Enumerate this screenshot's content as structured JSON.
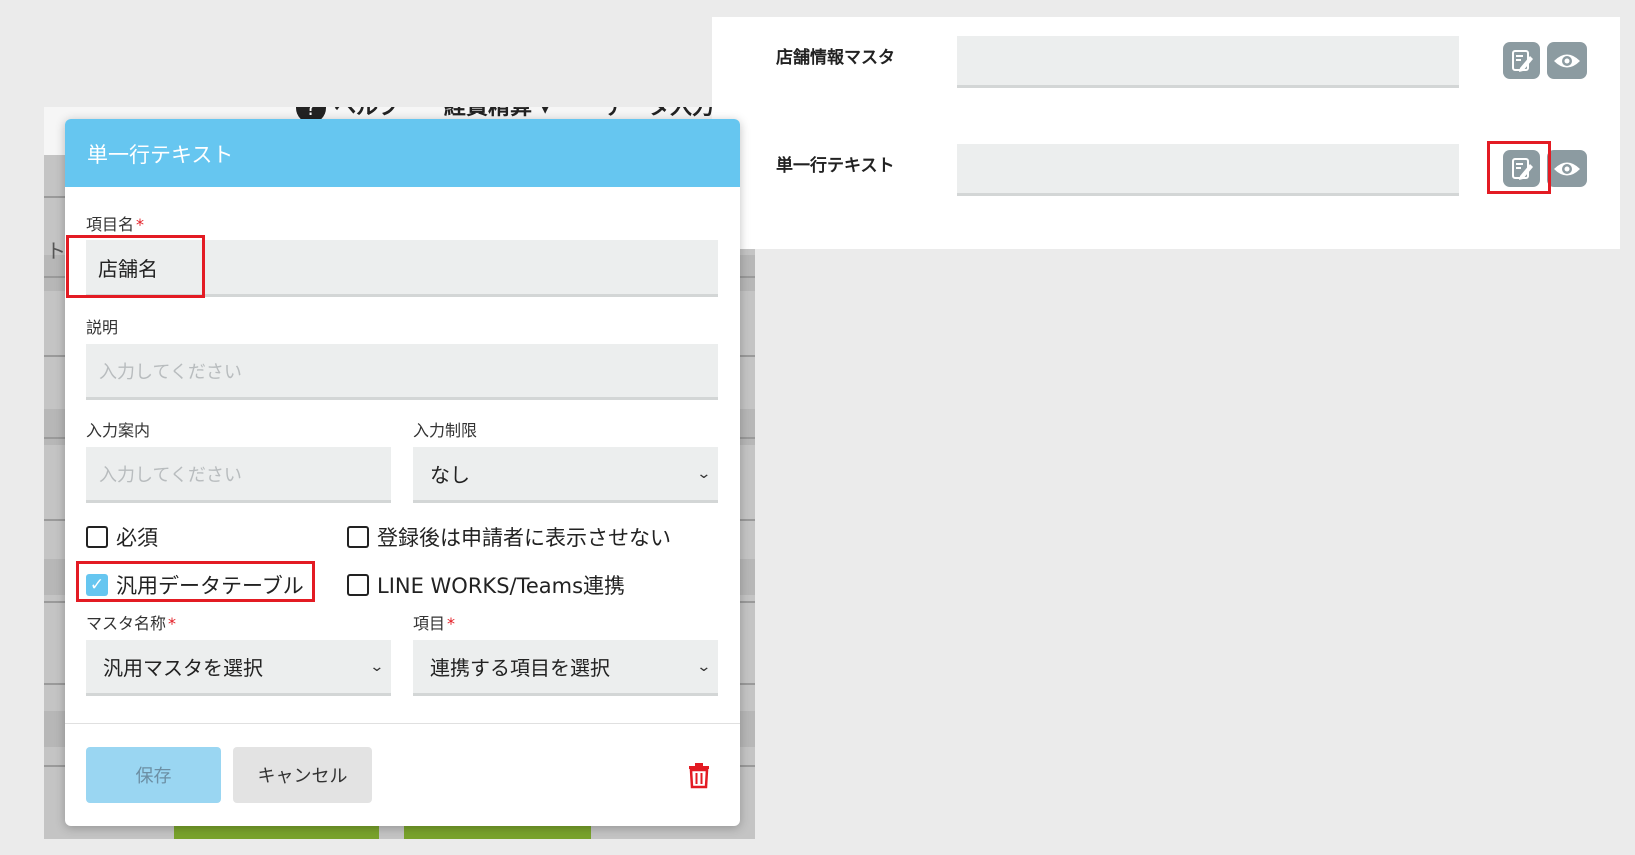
{
  "right_panel": {
    "rows": [
      {
        "label": "店舗情報マスタ"
      },
      {
        "label": "単一行テキスト"
      }
    ],
    "icons": {
      "edit": "edit-icon",
      "view": "eye-icon"
    }
  },
  "background": {
    "topbar_items": [
      "ヘルプ",
      "経費精算 ▾",
      "データ入力"
    ],
    "side_char": "ト"
  },
  "dialog": {
    "title": "単一行テキスト",
    "item_name_label": "項目名",
    "item_name_value": "店舗名",
    "required_mark": "*",
    "description_label": "説明",
    "description_placeholder": "入力してください",
    "input_guide_label": "入力案内",
    "input_guide_placeholder": "入力してください",
    "input_limit_label": "入力制限",
    "input_limit_value": "なし",
    "checkboxes": [
      {
        "label": "必須",
        "checked": false
      },
      {
        "label": "登録後は申請者に表示させない",
        "checked": false
      },
      {
        "label": "汎用データテーブル",
        "checked": true
      },
      {
        "label": "LINE WORKS/Teams連携",
        "checked": false
      }
    ],
    "master_name_label": "マスタ名称",
    "master_name_value": "汎用マスタを選択",
    "item_label": "項目",
    "item_value": "連携する項目を選択",
    "save_label": "保存",
    "cancel_label": "キャンセル"
  },
  "colors": {
    "header_blue": "#66c6f0",
    "highlight_red": "#e31b23",
    "icon_gray": "#8c9ba1",
    "trash_red": "#e31b23"
  }
}
